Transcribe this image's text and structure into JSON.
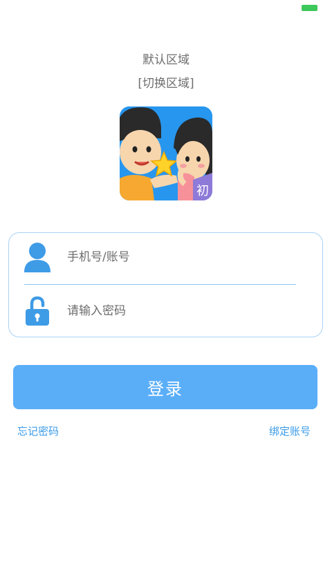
{
  "region": {
    "current": "默认区域",
    "switch_label": "[切换区域]"
  },
  "logo": {
    "badge": "初"
  },
  "form": {
    "username_placeholder": "手机号/账号",
    "password_placeholder": "请输入密码"
  },
  "actions": {
    "login": "登录",
    "forgot_password": "忘记密码",
    "bind_account": "绑定账号"
  },
  "colors": {
    "accent": "#5aaef8",
    "link": "#3a9be8",
    "icon": "#3e9be6",
    "battery": "#3cc85a"
  }
}
